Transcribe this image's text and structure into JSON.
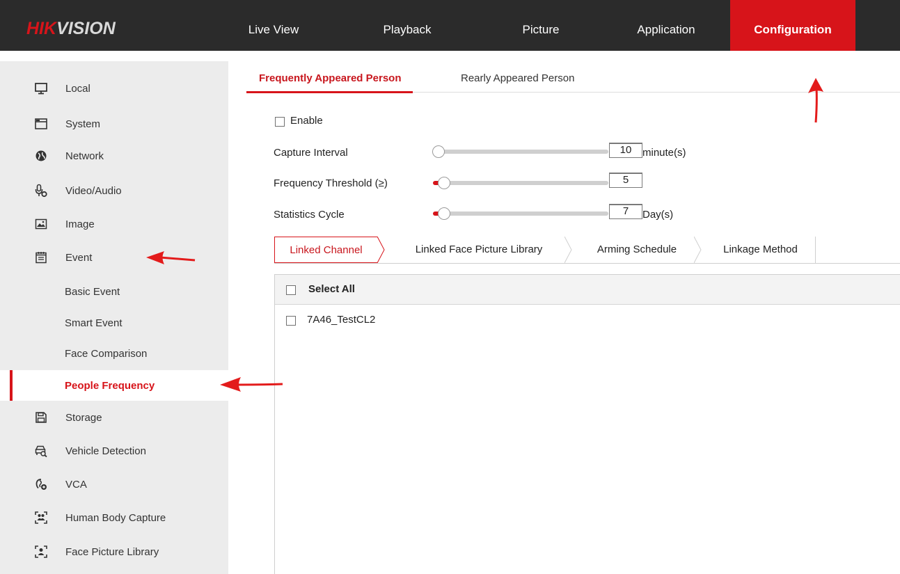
{
  "brand": {
    "logo_hik": "HIK",
    "logo_vision": "VISION"
  },
  "topnav": {
    "items": [
      {
        "label": "Live View"
      },
      {
        "label": "Playback"
      },
      {
        "label": "Picture"
      },
      {
        "label": "Application"
      },
      {
        "label": "Configuration"
      }
    ],
    "active": "Configuration"
  },
  "sidebar": {
    "items": [
      {
        "label": "Local",
        "icon": "monitor-icon"
      },
      {
        "label": "System",
        "icon": "window-icon"
      },
      {
        "label": "Network",
        "icon": "globe-icon"
      },
      {
        "label": "Video/Audio",
        "icon": "microphone-icon"
      },
      {
        "label": "Image",
        "icon": "image-icon"
      },
      {
        "label": "Event",
        "icon": "calendar-icon"
      },
      {
        "label": "Basic Event"
      },
      {
        "label": "Smart Event"
      },
      {
        "label": "Face Comparison"
      },
      {
        "label": "People Frequency"
      },
      {
        "label": "Storage",
        "icon": "floppy-icon"
      },
      {
        "label": "Vehicle Detection",
        "icon": "vehicle-search-icon"
      },
      {
        "label": "VCA",
        "icon": "vca-icon"
      },
      {
        "label": "Human Body Capture",
        "icon": "body-capture-icon"
      },
      {
        "label": "Face Picture Library",
        "icon": "face-library-icon"
      }
    ],
    "active": "People Frequency"
  },
  "main": {
    "tabs": [
      {
        "label": "Frequently Appeared Person"
      },
      {
        "label": "Rearly Appeared Person"
      }
    ],
    "active_tab": "Frequently Appeared Person",
    "enable": {
      "label": "Enable",
      "checked": false
    },
    "capture_interval": {
      "label": "Capture Interval",
      "value": "10",
      "unit": "minute(s)"
    },
    "frequency_threshold": {
      "label": "Frequency Threshold (≥)",
      "value": "5",
      "unit": ""
    },
    "statistics_cycle": {
      "label": "Statistics Cycle",
      "value": "7",
      "unit": "Day(s)"
    },
    "sub_tabs": [
      {
        "label": "Linked Channel"
      },
      {
        "label": "Linked Face Picture Library"
      },
      {
        "label": "Arming Schedule"
      },
      {
        "label": "Linkage Method"
      }
    ],
    "active_sub_tab": "Linked Channel",
    "table": {
      "select_all": "Select All",
      "channels": [
        {
          "label": "7A46_TestCL2",
          "checked": false
        }
      ]
    }
  },
  "colors": {
    "accent": "#d7141a",
    "topbar": "#2b2b2b",
    "sidebar": "#ececec"
  }
}
